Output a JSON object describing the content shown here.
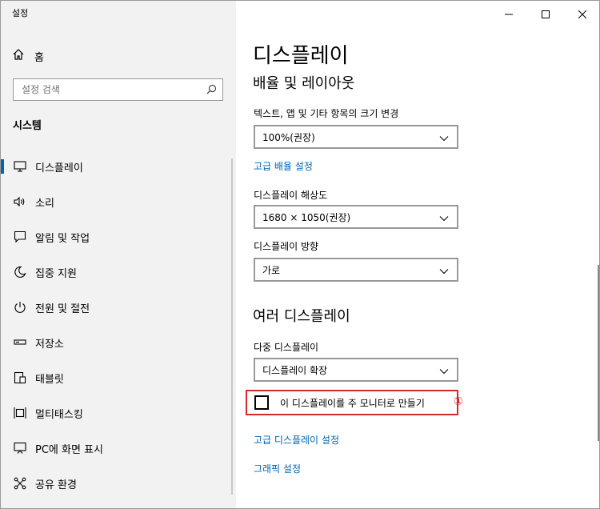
{
  "window": {
    "app_title": "설정",
    "controls": {
      "minimize": "minimize-icon",
      "maximize": "maximize-icon",
      "close": "close-icon"
    }
  },
  "sidebar": {
    "home": {
      "label": "홈",
      "icon": "home-icon"
    },
    "search": {
      "placeholder": "설정 검색",
      "icon": "search-icon"
    },
    "section": "시스템",
    "items": [
      {
        "label": "디스플레이",
        "icon": "monitor-icon",
        "active": true
      },
      {
        "label": "소리",
        "icon": "speaker-icon"
      },
      {
        "label": "알림 및 작업",
        "icon": "notification-icon"
      },
      {
        "label": "집중 지원",
        "icon": "moon-icon"
      },
      {
        "label": "전원 및 절전",
        "icon": "power-icon"
      },
      {
        "label": "저장소",
        "icon": "storage-icon"
      },
      {
        "label": "태블릿",
        "icon": "tablet-icon"
      },
      {
        "label": "멀티태스킹",
        "icon": "multitasking-icon"
      },
      {
        "label": "PC에 화면 표시",
        "icon": "project-icon"
      },
      {
        "label": "공유 환경",
        "icon": "share-icon"
      }
    ]
  },
  "main": {
    "title": "디스플레이",
    "scale_section": "배율 및 레이아웃",
    "scale_label": "텍스트, 앱 및 기타 항목의 크기 변경",
    "scale_value": "100%(권장)",
    "advanced_scale_link": "고급 배율 설정",
    "resolution_label": "디스플레이 해상도",
    "resolution_value": "1680 × 1050(권장)",
    "orientation_label": "디스플레이 방향",
    "orientation_value": "가로",
    "multi_section": "여러 디스플레이",
    "multi_label": "다중 디스플레이",
    "multi_value": "디스플레이 확장",
    "main_display_checkbox": "이 디스플레이를 주 모니터로 만들기",
    "callout_marker": "①",
    "advanced_display_link": "고급 디스플레이 설정",
    "graphics_link": "그래픽 설정"
  },
  "colors": {
    "accent": "#0063b1",
    "highlight": "#d32a2a",
    "sidebar_bg": "#f2f2f2"
  }
}
